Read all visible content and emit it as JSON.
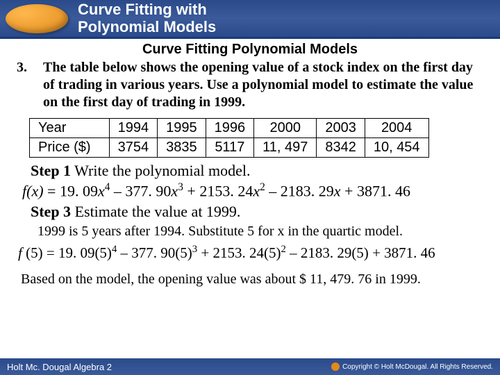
{
  "header": {
    "title_l1": "Curve Fitting with",
    "title_l2": "Polynomial Models"
  },
  "subtitle": "Curve Fitting Polynomial Models",
  "problem": {
    "num": "3.",
    "text": "The table below shows the opening value of a stock index on the first day of trading in various years. Use a polynomial model to estimate the value on the first day of trading in 1999."
  },
  "table": {
    "r1": [
      "Year",
      "1994",
      "1995",
      "1996",
      "2000",
      "2003",
      "2004"
    ],
    "r2": [
      "Price ($)",
      "3754",
      "3835",
      "5117",
      "11, 497",
      "8342",
      "10, 454"
    ]
  },
  "step1": {
    "label": "Step 1",
    "text": "  Write the polynomial model."
  },
  "eq1": {
    "lhs": "f(x)",
    "a": "19. 09",
    "b": "377. 90",
    "c": "2153. 24",
    "d": "2183. 29",
    "e": "3871. 46"
  },
  "step3": {
    "label": "Step 3",
    "text": "  Estimate the value at 1999."
  },
  "substep": "1999 is 5 years after 1994. Substitute 5 for x in the quartic model.",
  "eq2": {
    "lhs": "f ",
    "arg": "(5)",
    "a": "19. 09(5)",
    "b": "377. 90(5)",
    "c": "2153. 24(5)",
    "d": "2183. 29(5)",
    "e": "3871. 46"
  },
  "conclusion": "Based on the model, the opening value was about $ 11, 479. 76 in 1999.",
  "footer": {
    "left": "Holt Mc. Dougal Algebra 2",
    "right": "Holt McDougal. All Rights Reserved."
  },
  "copyright_label": "Copyright ©"
}
